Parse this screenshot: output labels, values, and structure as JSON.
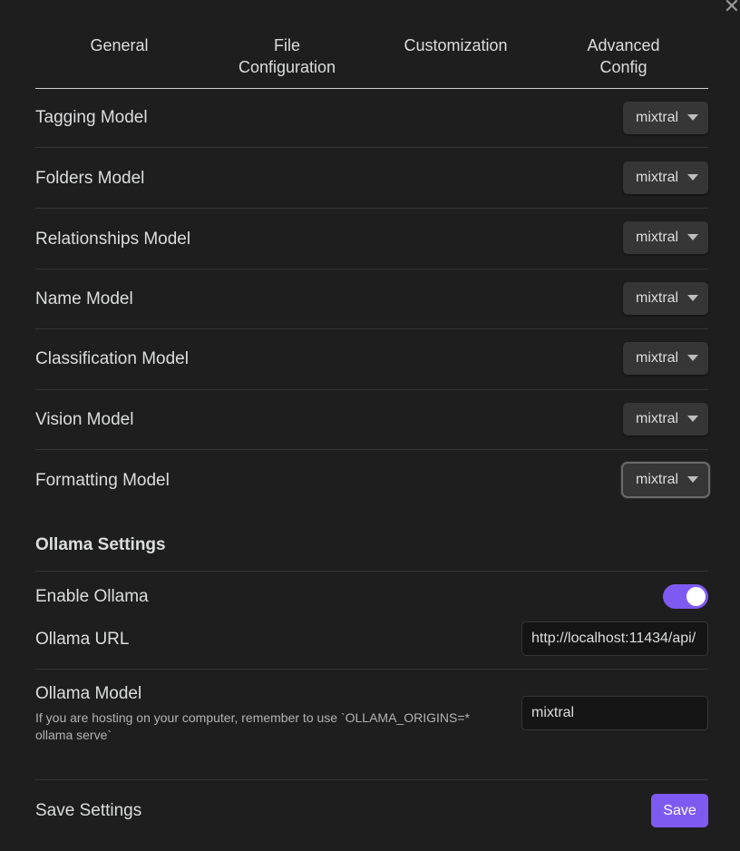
{
  "close_icon_glyph": "✕",
  "tabs": [
    {
      "line1": "General",
      "line2": ""
    },
    {
      "line1": "File",
      "line2": "Configuration"
    },
    {
      "line1": "Customization",
      "line2": ""
    },
    {
      "line1": "Advanced",
      "line2": "Config"
    }
  ],
  "models": [
    {
      "label": "Tagging Model",
      "value": "mixtral"
    },
    {
      "label": "Folders Model",
      "value": "mixtral"
    },
    {
      "label": "Relationships Model",
      "value": "mixtral"
    },
    {
      "label": "Name Model",
      "value": "mixtral"
    },
    {
      "label": "Classification Model",
      "value": "mixtral"
    },
    {
      "label": "Vision Model",
      "value": "mixtral"
    },
    {
      "label": "Formatting Model",
      "value": "mixtral"
    }
  ],
  "ollama": {
    "section_title": "Ollama Settings",
    "enable_label": "Enable Ollama",
    "enable_value": true,
    "url_label": "Ollama URL",
    "url_value": "http://localhost:11434/api/",
    "model_label": "Ollama Model",
    "model_description": "If you are hosting on your computer, remember to use `OLLAMA_ORIGINS=* ollama serve`",
    "model_value": "mixtral"
  },
  "save": {
    "label": "Save Settings",
    "button": "Save"
  },
  "colors": {
    "accent": "#7f5af0",
    "background": "#1e1e1e",
    "dropdown": "#363636"
  }
}
